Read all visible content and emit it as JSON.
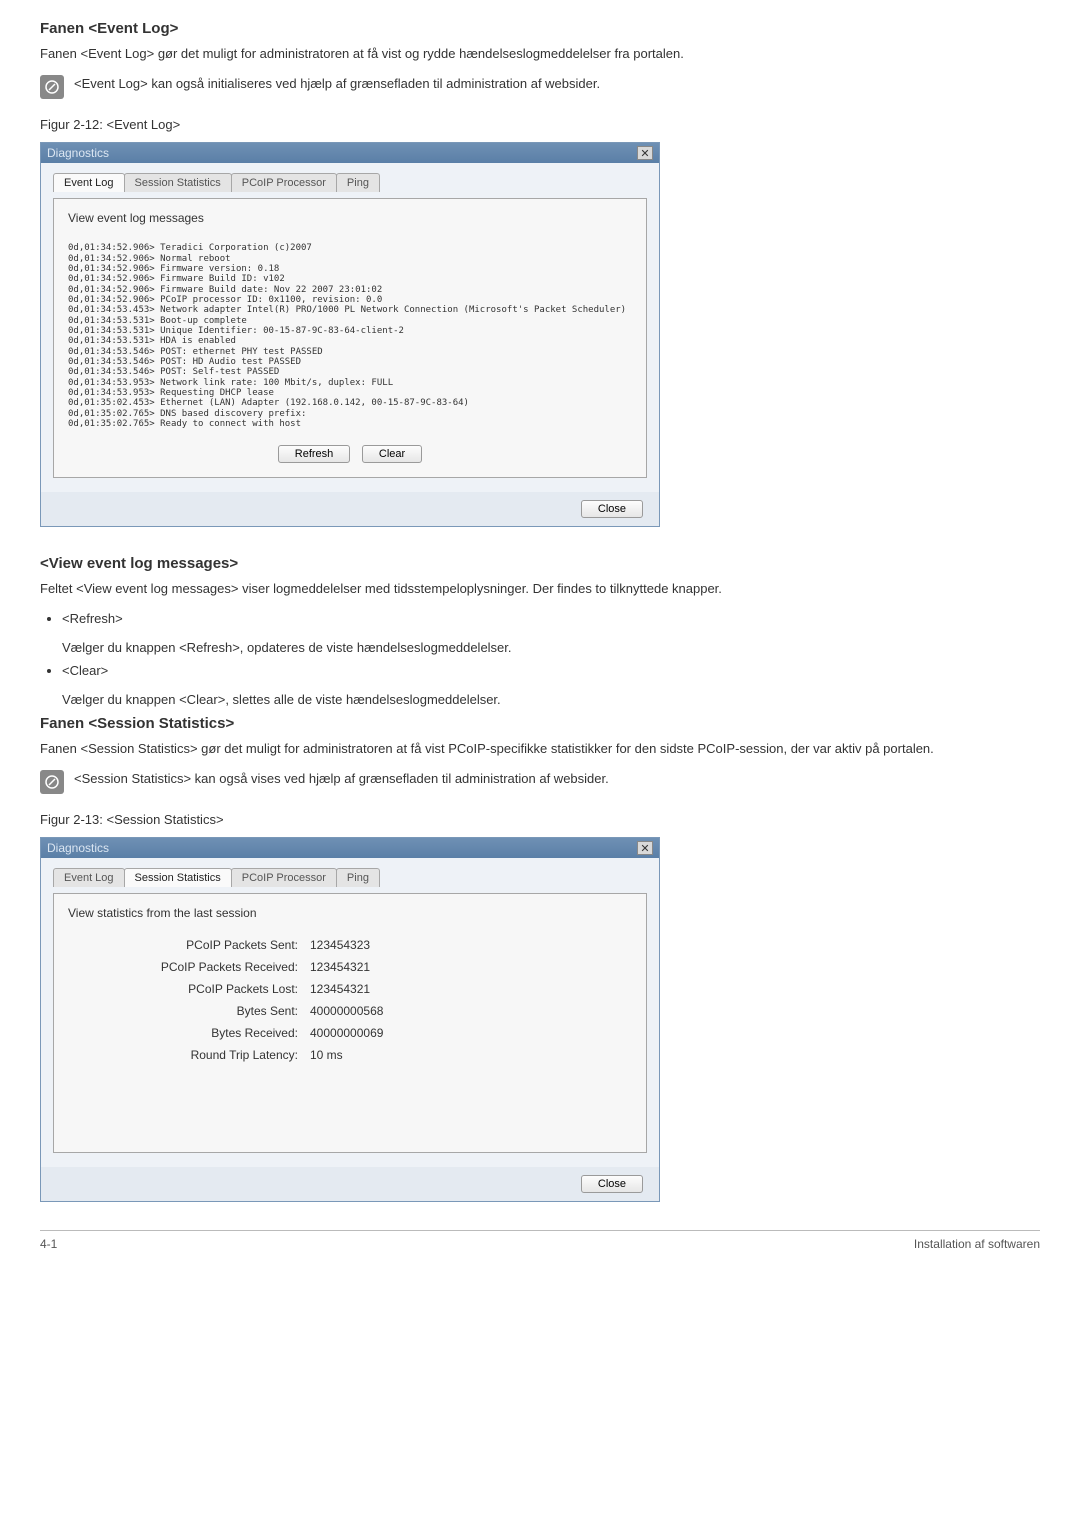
{
  "section1": {
    "title": "Fanen <Event Log>",
    "intro": "Fanen <Event Log> gør det muligt for administratoren at få vist og rydde hændelseslogmeddelelser fra portalen.",
    "note": "<Event Log> kan også initialiseres ved hjælp af grænsefladen til administration af websider.",
    "figure_caption": "Figur 2-12: <Event Log>"
  },
  "dialog1": {
    "title": "Diagnostics",
    "tabs": [
      "Event Log",
      "Session Statistics",
      "PCoIP Processor",
      "Ping"
    ],
    "active_tab": 0,
    "panel_heading": "View event log messages",
    "log_text": "0d,01:34:52.906> Teradici Corporation (c)2007\n0d,01:34:52.906> Normal reboot\n0d,01:34:52.906> Firmware version: 0.18\n0d,01:34:52.906> Firmware Build ID: v102\n0d,01:34:52.906> Firmware Build date: Nov 22 2007 23:01:02\n0d,01:34:52.906> PCoIP processor ID: 0x1100, revision: 0.0\n0d,01:34:53.453> Network adapter Intel(R) PRO/1000 PL Network Connection (Microsoft's Packet Scheduler)\n0d,01:34:53.531> Boot-up complete\n0d,01:34:53.531> Unique Identifier: 00-15-87-9C-83-64-client-2\n0d,01:34:53.531> HDA is enabled\n0d,01:34:53.546> POST: ethernet PHY test PASSED\n0d,01:34:53.546> POST: HD Audio test PASSED\n0d,01:34:53.546> POST: Self-test PASSED\n0d,01:34:53.953> Network link rate: 100 Mbit/s, duplex: FULL\n0d,01:34:53.953> Requesting DHCP lease\n0d,01:35:02.453> Ethernet (LAN) Adapter (192.168.0.142, 00-15-87-9C-83-64)\n0d,01:35:02.765> DNS based discovery prefix:\n0d,01:35:02.765> Ready to connect with host",
    "btn_refresh": "Refresh",
    "btn_clear": "Clear",
    "btn_close": "Close"
  },
  "section2": {
    "title": "<View event log messages>",
    "intro": "Feltet <View event log messages> viser logmeddelelser med tidsstempeloplysninger. Der findes to tilknyttede knapper.",
    "bullets": [
      {
        "label": "<Refresh>",
        "desc": "Vælger du knappen <Refresh>, opdateres de viste hændelseslogmeddelelser."
      },
      {
        "label": "<Clear>",
        "desc": "Vælger du knappen <Clear>, slettes alle de viste hændelseslogmeddelelser."
      }
    ]
  },
  "section3": {
    "title": "Fanen <Session Statistics>",
    "intro": "Fanen <Session Statistics> gør det muligt for administratoren at få vist PCoIP-specifikke statistikker for den sidste PCoIP-session, der var aktiv på portalen.",
    "note": "<Session Statistics> kan også vises ved hjælp af grænsefladen til administration af websider.",
    "figure_caption": "Figur 2-13: <Session Statistics>"
  },
  "dialog2": {
    "title": "Diagnostics",
    "tabs": [
      "Event Log",
      "Session Statistics",
      "PCoIP Processor",
      "Ping"
    ],
    "active_tab": 1,
    "panel_heading": "View statistics from the last session",
    "stats": [
      {
        "label": "PCoIP Packets Sent:",
        "value": "123454323"
      },
      {
        "label": "PCoIP Packets Received:",
        "value": "123454321"
      },
      {
        "label": "PCoIP Packets Lost:",
        "value": "123454321"
      },
      {
        "label": "Bytes Sent:",
        "value": "40000000568"
      },
      {
        "label": "Bytes Received:",
        "value": "40000000069"
      },
      {
        "label": "Round Trip Latency:",
        "value": "10 ms"
      }
    ],
    "btn_close": "Close"
  },
  "footer": {
    "left": "4-1",
    "right": "Installation af softwaren"
  }
}
